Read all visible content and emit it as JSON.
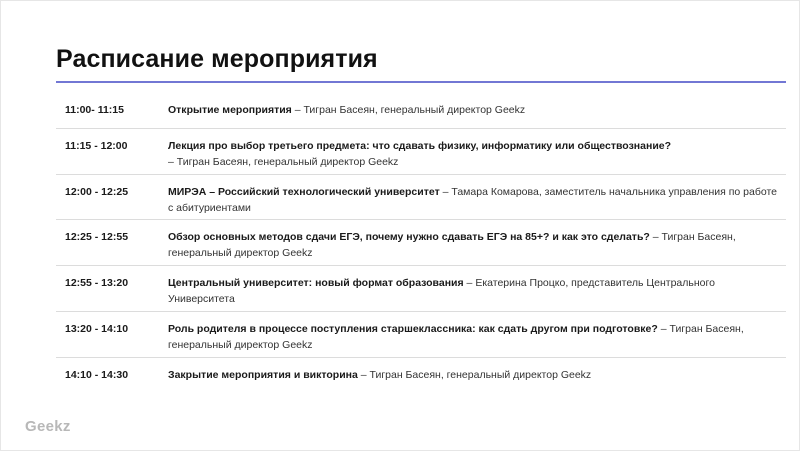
{
  "title": "Расписание мероприятия",
  "brand": "Geekz",
  "accent_color": "#7277d4",
  "schedule": [
    {
      "time": "11:00- 11:15",
      "event": "Открытие мероприятия",
      "speaker": " – Тигран Басеян, генеральный директор Geekz"
    },
    {
      "time": "11:15 - 12:00",
      "event": "Лекция про выбор третьего предмета: что сдавать физику, информатику или обществознание?",
      "speaker": " – Тигран Басеян, генеральный директор Geekz"
    },
    {
      "time": "12:00 - 12:25",
      "event": "МИРЭА – Российский технологический университет",
      "speaker": " – Тамара Комарова, заместитель начальника управления по работе с абитуриентами"
    },
    {
      "time": "12:25 - 12:55",
      "event": "Обзор основных методов сдачи ЕГЭ, почему нужно сдавать ЕГЭ на 85+? и как это сделать?",
      "speaker": " – Тигран Басеян, генеральный директор Geekz"
    },
    {
      "time": "12:55 - 13:20",
      "event": "Центральный университет: новый формат образования",
      "speaker": "  – Екатерина Процко, представитель Центрального Университета"
    },
    {
      "time": "13:20 - 14:10",
      "event": "Роль родителя в процессе поступления старшеклассника: как сдать другом при подготовке?",
      "speaker": " – Тигран Басеян, генеральный директор Geekz"
    },
    {
      "time": "14:10 - 14:30",
      "event": "Закрытие мероприятия и викторина",
      "speaker": " – Тигран Басеян, генеральный директор Geekz"
    }
  ]
}
